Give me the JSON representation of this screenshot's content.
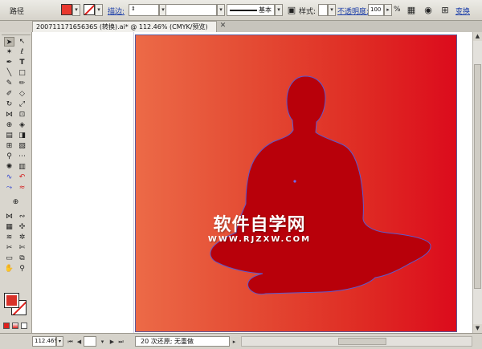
{
  "control_bar": {
    "panel_title": "路径",
    "fill_color": "#e8382e",
    "stroke_color": "#e0201c",
    "stroke_label": "描边:",
    "stroke_style_label": "基本",
    "style_label": "样式:",
    "opacity_label": "不透明度:",
    "opacity_value": "100",
    "opacity_unit": "%",
    "transform_label": "变换"
  },
  "document": {
    "tab_title": "20071117165636S (转换).ai* @ 112.46% (CMYK/预览)"
  },
  "canvas": {
    "artboard_gradient": [
      "#ec6a47",
      "#dc0b1c"
    ],
    "silhouette_color": "#b8000a",
    "watermark_main": "软件自学网",
    "watermark_sub": "WWW.RJZXW.COM"
  },
  "status_bar": {
    "zoom_value": "112.46%",
    "status_text": "20 次还原; 无重做"
  }
}
